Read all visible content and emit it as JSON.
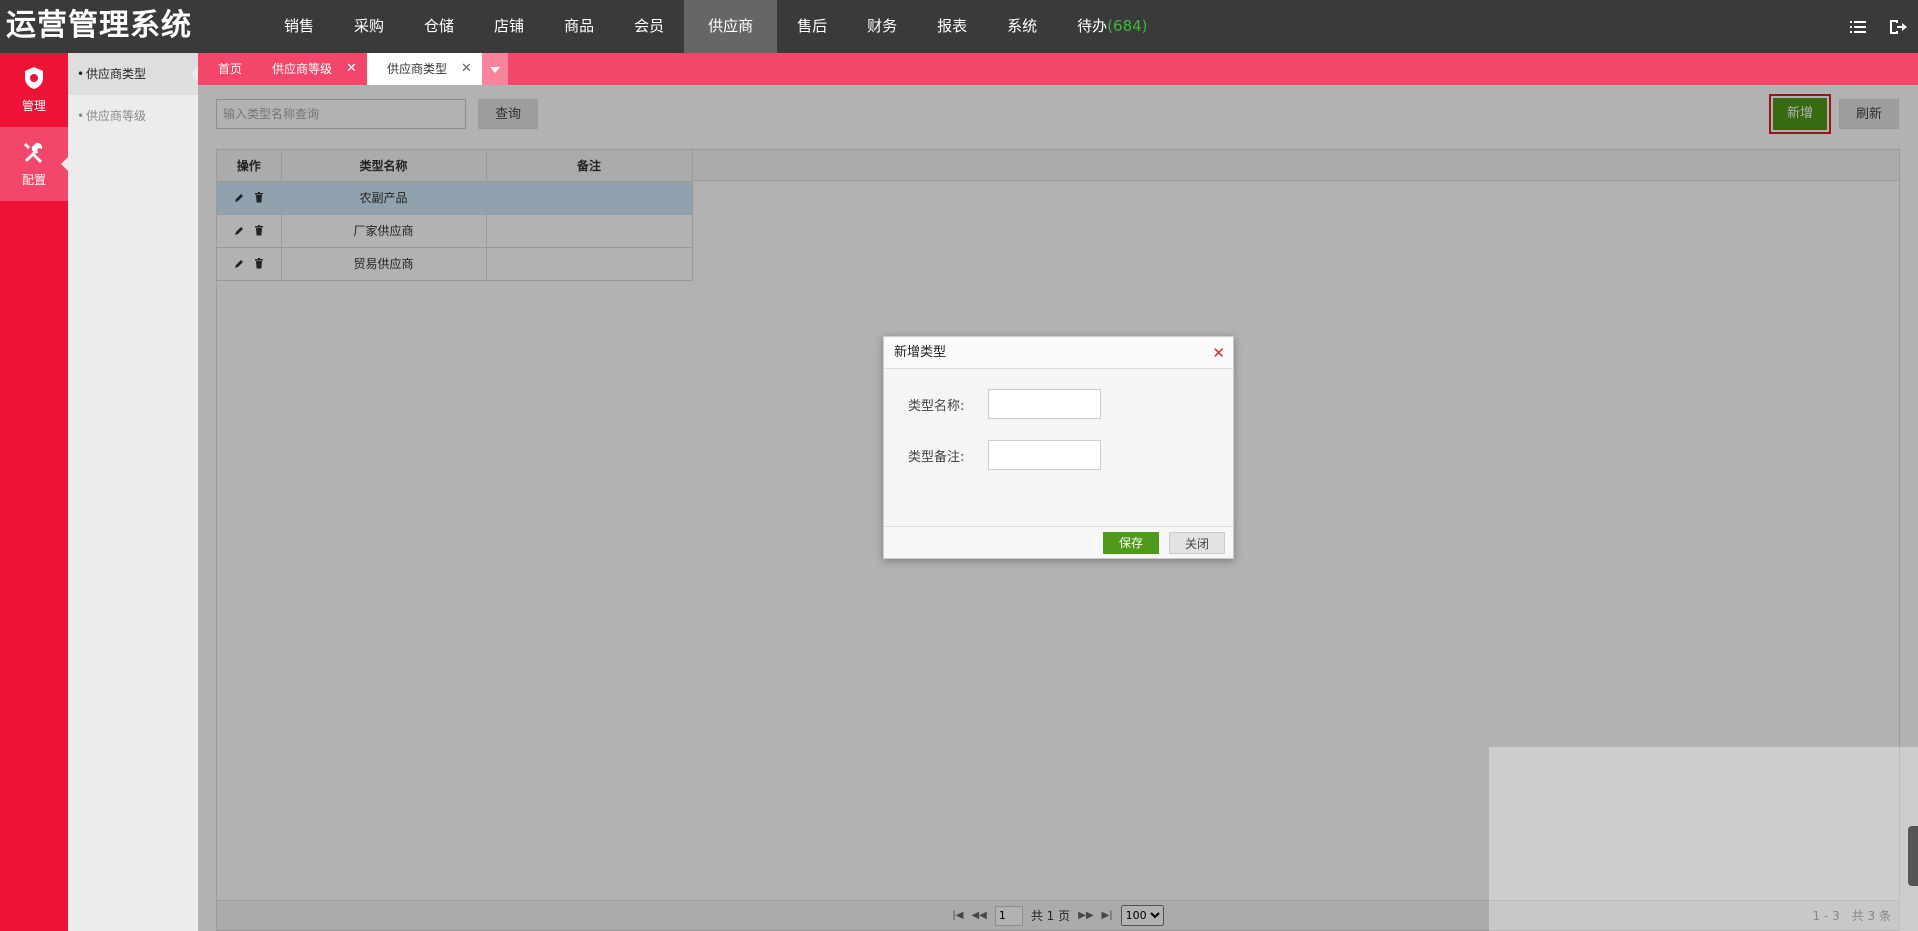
{
  "app": {
    "title": "运营管理系统"
  },
  "topnav": {
    "items": [
      {
        "label": "销售"
      },
      {
        "label": "采购"
      },
      {
        "label": "仓储"
      },
      {
        "label": "店铺"
      },
      {
        "label": "商品"
      },
      {
        "label": "会员"
      },
      {
        "label": "供应商"
      },
      {
        "label": "售后"
      },
      {
        "label": "财务"
      },
      {
        "label": "报表"
      },
      {
        "label": "系统"
      }
    ],
    "active": "供应商",
    "pending": {
      "label": "待办",
      "count": "(684)"
    }
  },
  "rail": {
    "items": [
      {
        "label": "管理",
        "icon": "shield-icon"
      },
      {
        "label": "配置",
        "icon": "tools-icon"
      }
    ],
    "active": "配置"
  },
  "submenu": {
    "items": [
      {
        "label": "供应商类型"
      },
      {
        "label": "供应商等级"
      }
    ],
    "active": "供应商类型"
  },
  "tabs": {
    "items": [
      {
        "label": "首页"
      },
      {
        "label": "供应商等级"
      },
      {
        "label": "供应商类型"
      }
    ],
    "active": "供应商类型"
  },
  "toolbar": {
    "search_placeholder": "输入类型名称查询",
    "query_label": "查询",
    "add_label": "新增",
    "refresh_label": "刷新"
  },
  "table": {
    "columns": [
      "操作",
      "类型名称",
      "备注"
    ],
    "rows": [
      {
        "name": "农副产品",
        "remark": ""
      },
      {
        "name": "厂家供应商",
        "remark": ""
      },
      {
        "name": "贸易供应商",
        "remark": ""
      }
    ],
    "selected_row": 0
  },
  "pager": {
    "current_page": "1",
    "total_pages_label": "共 1 页",
    "page_size": "100",
    "summary": "1 - 3　共 3 条"
  },
  "dialog": {
    "title": "新增类型",
    "fields": [
      {
        "label": "类型名称:",
        "value": ""
      },
      {
        "label": "类型备注:",
        "value": ""
      }
    ],
    "save_label": "保存",
    "close_label": "关闭"
  },
  "colors": {
    "accent_red": "#ee1236",
    "tab_pink": "#f2476a",
    "topbar": "#3a3a3a",
    "green_button": "#4f9a1a",
    "selected_row": "#cfe8f8",
    "pending_count": "#3cb83c"
  }
}
